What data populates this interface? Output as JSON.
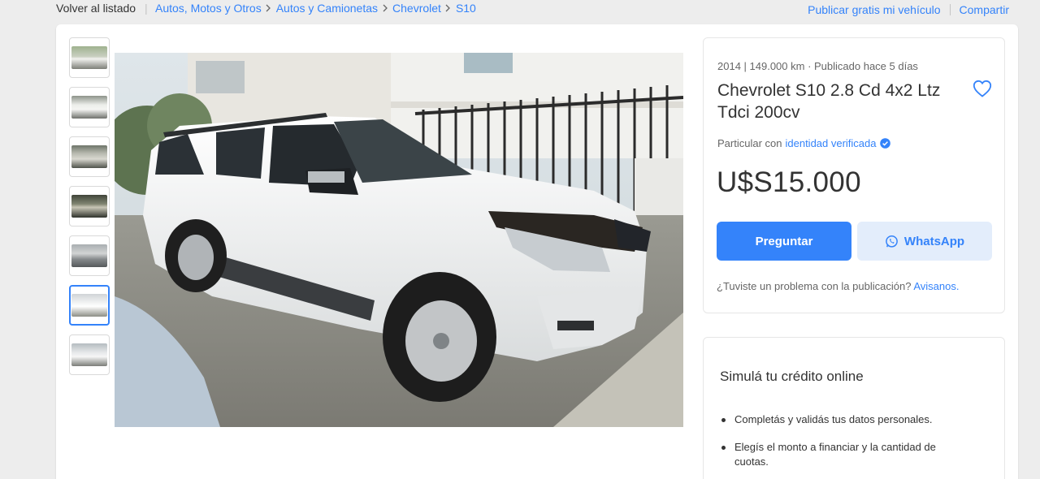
{
  "breadcrumb": {
    "back_label": "Volver al listado",
    "separator": "|",
    "items": [
      "Autos, Motos y Otros",
      "Autos y Camionetas",
      "Chevrolet",
      "S10"
    ]
  },
  "header_links": {
    "publish": "Publicar gratis mi vehículo",
    "share": "Compartir"
  },
  "gallery": {
    "thumbnail_count": 7,
    "active_index": 5,
    "photo_alt": "Chevrolet S10 blanca"
  },
  "listing": {
    "subtitle": "2014 | 149.000 km · Publicado hace 5 días",
    "title": "Chevrolet S10 2.8 Cd 4x2 Ltz Tdci 200cv",
    "seller_prefix": "Particular con",
    "seller_link": "identidad verificada",
    "price": "U$S15.000",
    "ask_button": "Preguntar",
    "whatsapp_button": "WhatsApp",
    "report_text": "¿Tuviste un problema con la publicación?",
    "report_link": "Avisanos."
  },
  "credit": {
    "title": "Simulá tu crédito online",
    "steps": [
      "Completás y validás tus datos personales.",
      "Elegís el monto a financiar y la cantidad de cuotas."
    ]
  },
  "colors": {
    "accent": "#3483fa",
    "accent_light": "#e3edfb",
    "background": "#ededed"
  }
}
